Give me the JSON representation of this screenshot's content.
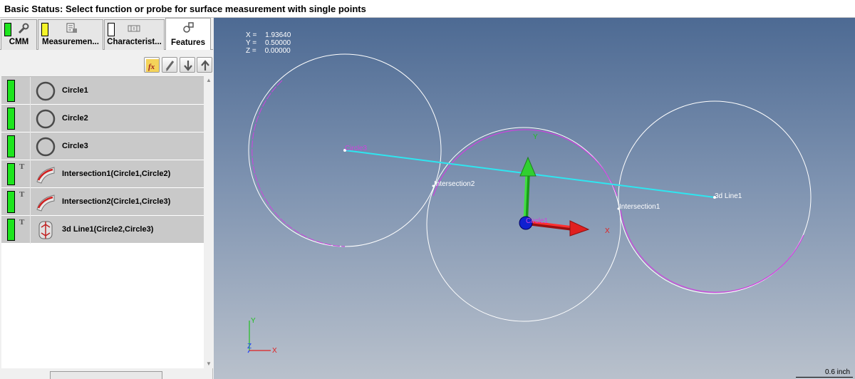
{
  "status": {
    "text": "Basic Status: Select function or probe for surface measurement with single points"
  },
  "tabs": [
    {
      "label": "CMM",
      "lamp": "green",
      "icon": "wrench-icon"
    },
    {
      "label": "Measuremen...",
      "lamp": "yellow",
      "icon": "measurement-plan-icon"
    },
    {
      "label": "Characterist...",
      "lamp": "white",
      "icon": "characteristic-icon"
    },
    {
      "label": "Features",
      "lamp": null,
      "icon": "features-icon",
      "active": true
    }
  ],
  "toolbar": {
    "buttons": [
      "formula-icon",
      "pencil-icon",
      "arrow-down-icon",
      "arrow-up-icon"
    ]
  },
  "features": [
    {
      "label": "Circle1",
      "icon": "circle-icon",
      "text_mark": ""
    },
    {
      "label": "Circle2",
      "icon": "circle-icon",
      "text_mark": ""
    },
    {
      "label": "Circle3",
      "icon": "circle-icon",
      "text_mark": ""
    },
    {
      "label": "Intersection1(Circle1,Circle2)",
      "icon": "intersection-icon",
      "text_mark": "T"
    },
    {
      "label": "Intersection2(Circle1,Circle3)",
      "icon": "intersection-icon",
      "text_mark": "T"
    },
    {
      "label": "3d Line1(Circle2,Circle3)",
      "icon": "line-3d-icon",
      "text_mark": "T"
    }
  ],
  "viewport": {
    "coords": [
      {
        "axis": "X =",
        "value": "1.93640"
      },
      {
        "axis": "Y =",
        "value": "0.50000"
      },
      {
        "axis": "Z =",
        "value": "0.00000"
      }
    ],
    "labels": {
      "circle3": "Circle3",
      "circle1": "Circle1",
      "intersection2": "Intersection2",
      "intersection1": "Intersection1",
      "line": "3d Line1",
      "axis_x": "X",
      "axis_y": "Y",
      "mini_x": "X",
      "mini_y": "Y",
      "mini_z": "Z"
    },
    "scale": "0.6 inch",
    "colors": {
      "circle": "#ffffff",
      "selected": "#d040e0",
      "line": "#2ee6f0",
      "x_axis": "#e02020",
      "y_axis": "#20c020",
      "origin": "#1020d0"
    }
  }
}
